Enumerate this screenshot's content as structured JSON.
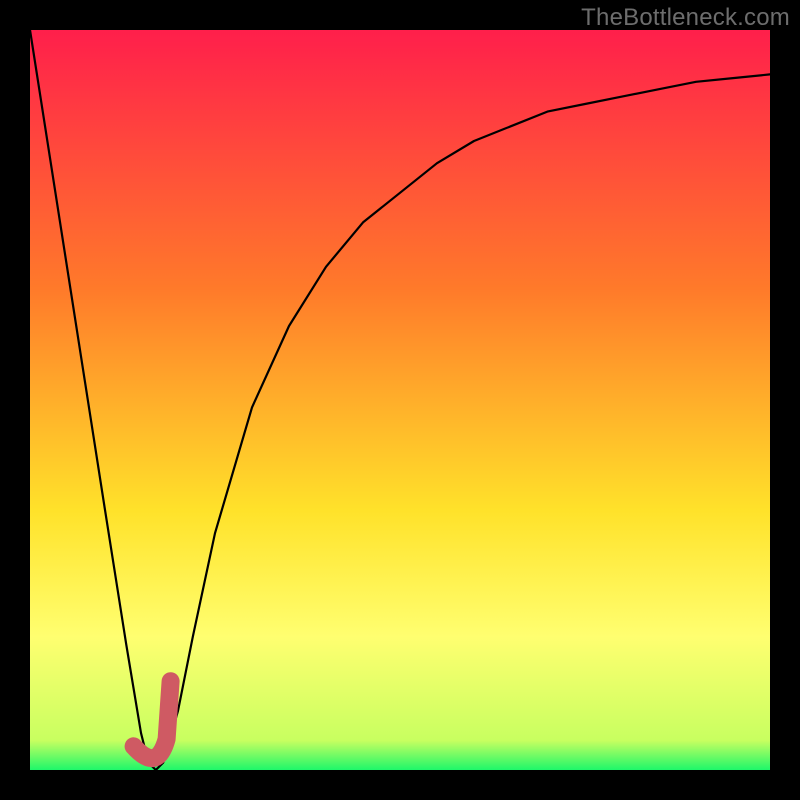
{
  "watermark": "TheBottleneck.com",
  "colors": {
    "frame": "#000000",
    "gradient_top": "#ff1f4b",
    "gradient_mid1": "#ff6a2c",
    "gradient_mid2": "#ffd92a",
    "gradient_mid3": "#ffff66",
    "gradient_bottom": "#1ef76a",
    "curve": "#000000",
    "marker": "#cf5a63",
    "watermark": "#6d6d6d"
  },
  "chart_data": {
    "type": "line",
    "title": "",
    "xlabel": "",
    "ylabel": "",
    "xlim": [
      0,
      100
    ],
    "ylim": [
      0,
      100
    ],
    "grid": false,
    "legend": false,
    "series": [
      {
        "name": "bottleneck-curve",
        "x": [
          0,
          5,
          10,
          13,
          15,
          16,
          17,
          18,
          20,
          22,
          25,
          30,
          35,
          40,
          45,
          50,
          55,
          60,
          65,
          70,
          75,
          80,
          85,
          90,
          95,
          100
        ],
        "y": [
          100,
          68,
          36,
          17,
          5,
          1,
          0,
          1,
          8,
          18,
          32,
          49,
          60,
          68,
          74,
          78,
          82,
          85,
          87,
          89,
          90,
          91,
          92,
          93,
          93.5,
          94
        ]
      }
    ],
    "marker": {
      "shape": "J",
      "x_range": [
        14,
        19
      ],
      "y_range": [
        0,
        12
      ]
    },
    "background_gradient": {
      "direction": "vertical",
      "stops": [
        {
          "pos": 0.0,
          "color": "#ff1f4b"
        },
        {
          "pos": 0.35,
          "color": "#ff7a2a"
        },
        {
          "pos": 0.65,
          "color": "#ffe22a"
        },
        {
          "pos": 0.82,
          "color": "#ffff70"
        },
        {
          "pos": 0.96,
          "color": "#c8ff60"
        },
        {
          "pos": 1.0,
          "color": "#1ef76a"
        }
      ]
    }
  }
}
